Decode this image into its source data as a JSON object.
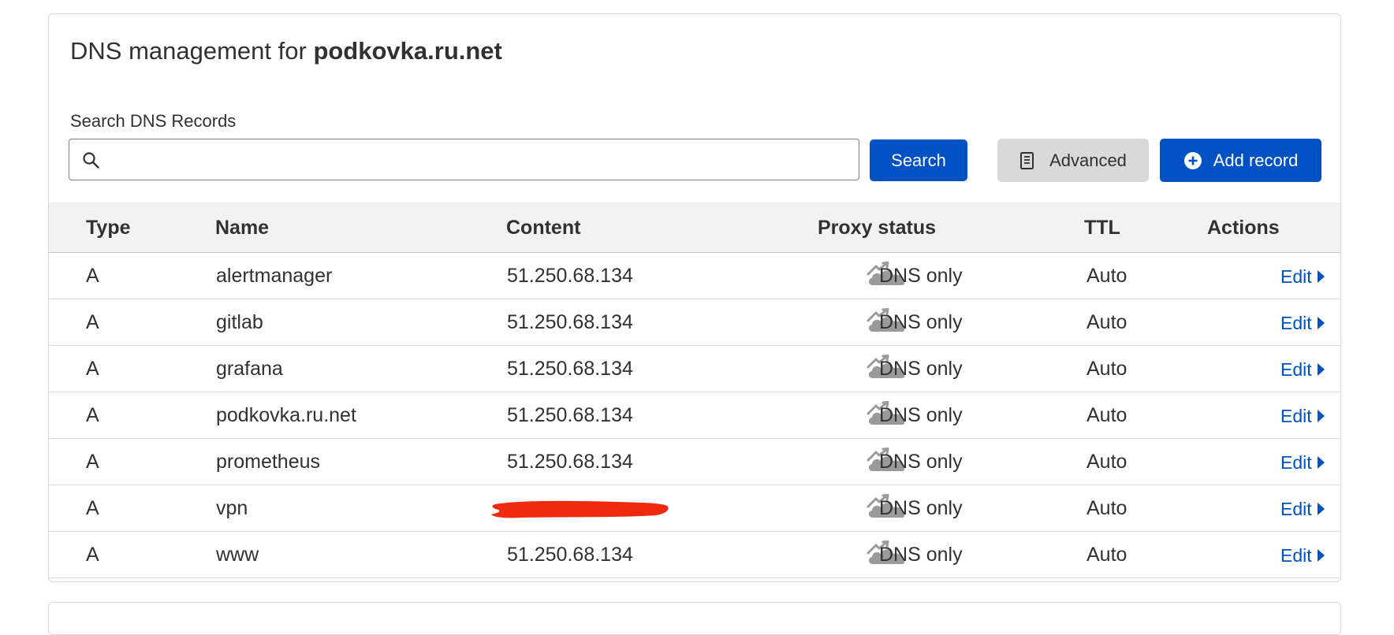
{
  "header": {
    "title_prefix": "DNS management for",
    "domain": "podkovka.ru.net"
  },
  "search": {
    "label": "Search DNS Records",
    "value": "",
    "placeholder": "",
    "button_label": "Search"
  },
  "toolbar": {
    "advanced_label": "Advanced",
    "add_record_label": "Add record"
  },
  "table": {
    "columns": {
      "type": "Type",
      "name": "Name",
      "content": "Content",
      "proxy_status": "Proxy status",
      "ttl": "TTL",
      "actions": "Actions"
    },
    "rows": [
      {
        "type": "A",
        "name": "alertmanager",
        "content": "51.250.68.134",
        "proxy": "DNS only",
        "ttl": "Auto",
        "action": "Edit"
      },
      {
        "type": "A",
        "name": "gitlab",
        "content": "51.250.68.134",
        "proxy": "DNS only",
        "ttl": "Auto",
        "action": "Edit"
      },
      {
        "type": "A",
        "name": "grafana",
        "content": "51.250.68.134",
        "proxy": "DNS only",
        "ttl": "Auto",
        "action": "Edit"
      },
      {
        "type": "A",
        "name": "podkovka.ru.net",
        "content": "51.250.68.134",
        "proxy": "DNS only",
        "ttl": "Auto",
        "action": "Edit"
      },
      {
        "type": "A",
        "name": "prometheus",
        "content": "51.250.68.134",
        "proxy": "DNS only",
        "ttl": "Auto",
        "action": "Edit"
      },
      {
        "type": "A",
        "name": "vpn",
        "content": "",
        "proxy": "DNS only",
        "ttl": "Auto",
        "action": "Edit",
        "redacted": true
      },
      {
        "type": "A",
        "name": "www",
        "content": "51.250.68.134",
        "proxy": "DNS only",
        "ttl": "Auto",
        "action": "Edit"
      }
    ]
  },
  "colors": {
    "primary": "#0051c3",
    "cloud_gray": "#9a9a9a",
    "redaction": "#f02a0e",
    "header_bg": "#f2f2f2"
  },
  "icons": {
    "search": "search-icon",
    "advanced": "document-icon",
    "add": "plus-circle-icon",
    "proxy": "cloud-dns-only-icon",
    "edit": "caret-right-icon"
  }
}
